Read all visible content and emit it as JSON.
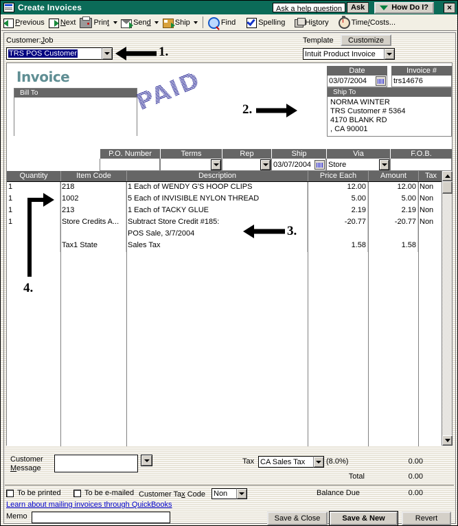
{
  "window": {
    "title": "Create Invoices",
    "title_icon": "invoice-window-icon",
    "close_label": "×",
    "help": {
      "placeholder": "Ask a help question",
      "ask_label": "Ask",
      "how_do_i_label": "How Do I?"
    },
    "accent_titlebar": "#0b6b58"
  },
  "toolbar": {
    "items": [
      {
        "label": "Previous",
        "icon": "previous-arrow-icon",
        "has_dropdown": false
      },
      {
        "label": "Next",
        "icon": "next-arrow-icon",
        "has_dropdown": false
      },
      {
        "label": "Print",
        "icon": "printer-icon",
        "has_dropdown": true
      },
      {
        "label": "Send",
        "icon": "envelope-send-icon",
        "has_dropdown": true
      },
      {
        "label": "Ship",
        "icon": "shipping-box-icon",
        "has_dropdown": true
      },
      {
        "label": "Find",
        "icon": "magnifier-icon",
        "has_dropdown": false
      },
      {
        "label": "Spelling",
        "icon": "spellcheck-icon",
        "has_dropdown": false
      },
      {
        "label": "History",
        "icon": "history-pages-icon",
        "has_dropdown": false
      },
      {
        "label": "Time/Costs...",
        "icon": "stopwatch-icon",
        "has_dropdown": false
      }
    ]
  },
  "header": {
    "customer_label": "Customer:Job",
    "customer_value": "TRS POS Customer",
    "template_label": "Template",
    "customize_label": "Customize",
    "template_value": "Intuit Product Invoice"
  },
  "invoice": {
    "heading": "Invoice",
    "stamp": "PAID",
    "bill_to_label": "Bill To",
    "bill_to_lines": [],
    "date_label": "Date",
    "date_value": "03/07/2004",
    "invoice_no_label": "Invoice #",
    "invoice_no_value": "trs14676",
    "ship_to_label": "Ship To",
    "ship_to_lines": [
      "NORMA WINTER",
      "TRS Customer # 5364",
      "4170 BLANK RD",
      ", CA 90001"
    ]
  },
  "strip": {
    "fields": [
      {
        "label": "P.O. Number",
        "value": "",
        "type": "text"
      },
      {
        "label": "Terms",
        "value": "",
        "type": "combo"
      },
      {
        "label": "Rep",
        "value": "",
        "type": "combo"
      },
      {
        "label": "Ship",
        "value": "03/07/2004",
        "type": "date"
      },
      {
        "label": "Via",
        "value": "Store",
        "type": "combo"
      },
      {
        "label": "F.O.B.",
        "value": "",
        "type": "text"
      }
    ]
  },
  "grid": {
    "columns": [
      "Quantity",
      "Item Code",
      "Description",
      "Price Each",
      "Amount",
      "Tax"
    ],
    "rows": [
      {
        "quantity": "1",
        "item_code": "218",
        "description": "1 Each of WENDY G'S HOOP CLIPS",
        "price_each": "12.00",
        "amount": "12.00",
        "tax": "Non"
      },
      {
        "quantity": "1",
        "item_code": "1002",
        "description": "5 Each of INVISIBLE NYLON THREAD",
        "price_each": "5.00",
        "amount": "5.00",
        "tax": "Non"
      },
      {
        "quantity": "1",
        "item_code": "213",
        "description": "1 Each of TACKY GLUE",
        "price_each": "2.19",
        "amount": "2.19",
        "tax": "Non"
      },
      {
        "quantity": "1",
        "item_code": "Store Credits A...",
        "description": "Subtract Store Credit #185:",
        "price_each": "-20.77",
        "amount": "-20.77",
        "tax": "Non"
      },
      {
        "quantity": "",
        "item_code": "",
        "description": "POS Sale, 3/7/2004",
        "price_each": "",
        "amount": "",
        "tax": ""
      },
      {
        "quantity": "",
        "item_code": "Tax1 State",
        "description": "Sales Tax",
        "price_each": "1.58",
        "amount": "1.58",
        "tax": ""
      }
    ]
  },
  "totals": {
    "customer_message_label_1": "Customer",
    "customer_message_label_2": "Message",
    "customer_message_value": "",
    "tax_label": "Tax",
    "tax_code_value": "CA Sales Tax",
    "tax_rate": "(8.0%)",
    "tax_amount": "0.00",
    "total_label": "Total",
    "total_amount": "0.00"
  },
  "footer": {
    "to_be_printed_label": "To be printed",
    "to_be_printed_checked": false,
    "to_be_emailed_label": "To be e-mailed",
    "to_be_emailed_checked": false,
    "customer_tax_code_label": "Customer Tax Code",
    "customer_tax_code_value": "Non",
    "balance_due_label": "Balance Due",
    "balance_due_amount": "0.00",
    "link_label": "Learn about mailing invoices through QuickBooks",
    "memo_label": "Memo",
    "memo_value": "",
    "save_close_label": "Save & Close",
    "save_new_label": "Save & New",
    "revert_label": "Revert"
  },
  "annotations": [
    {
      "id": "1",
      "label": "1.",
      "direction": "left",
      "target": "customer-job-combo"
    },
    {
      "id": "2",
      "label": "2.",
      "direction": "right",
      "target": "paid-stamp"
    },
    {
      "id": "3",
      "label": "3.",
      "direction": "left",
      "target": "store-credit-line"
    },
    {
      "id": "4",
      "label": "4.",
      "direction": "up-right",
      "target": "quantity-column"
    }
  ]
}
